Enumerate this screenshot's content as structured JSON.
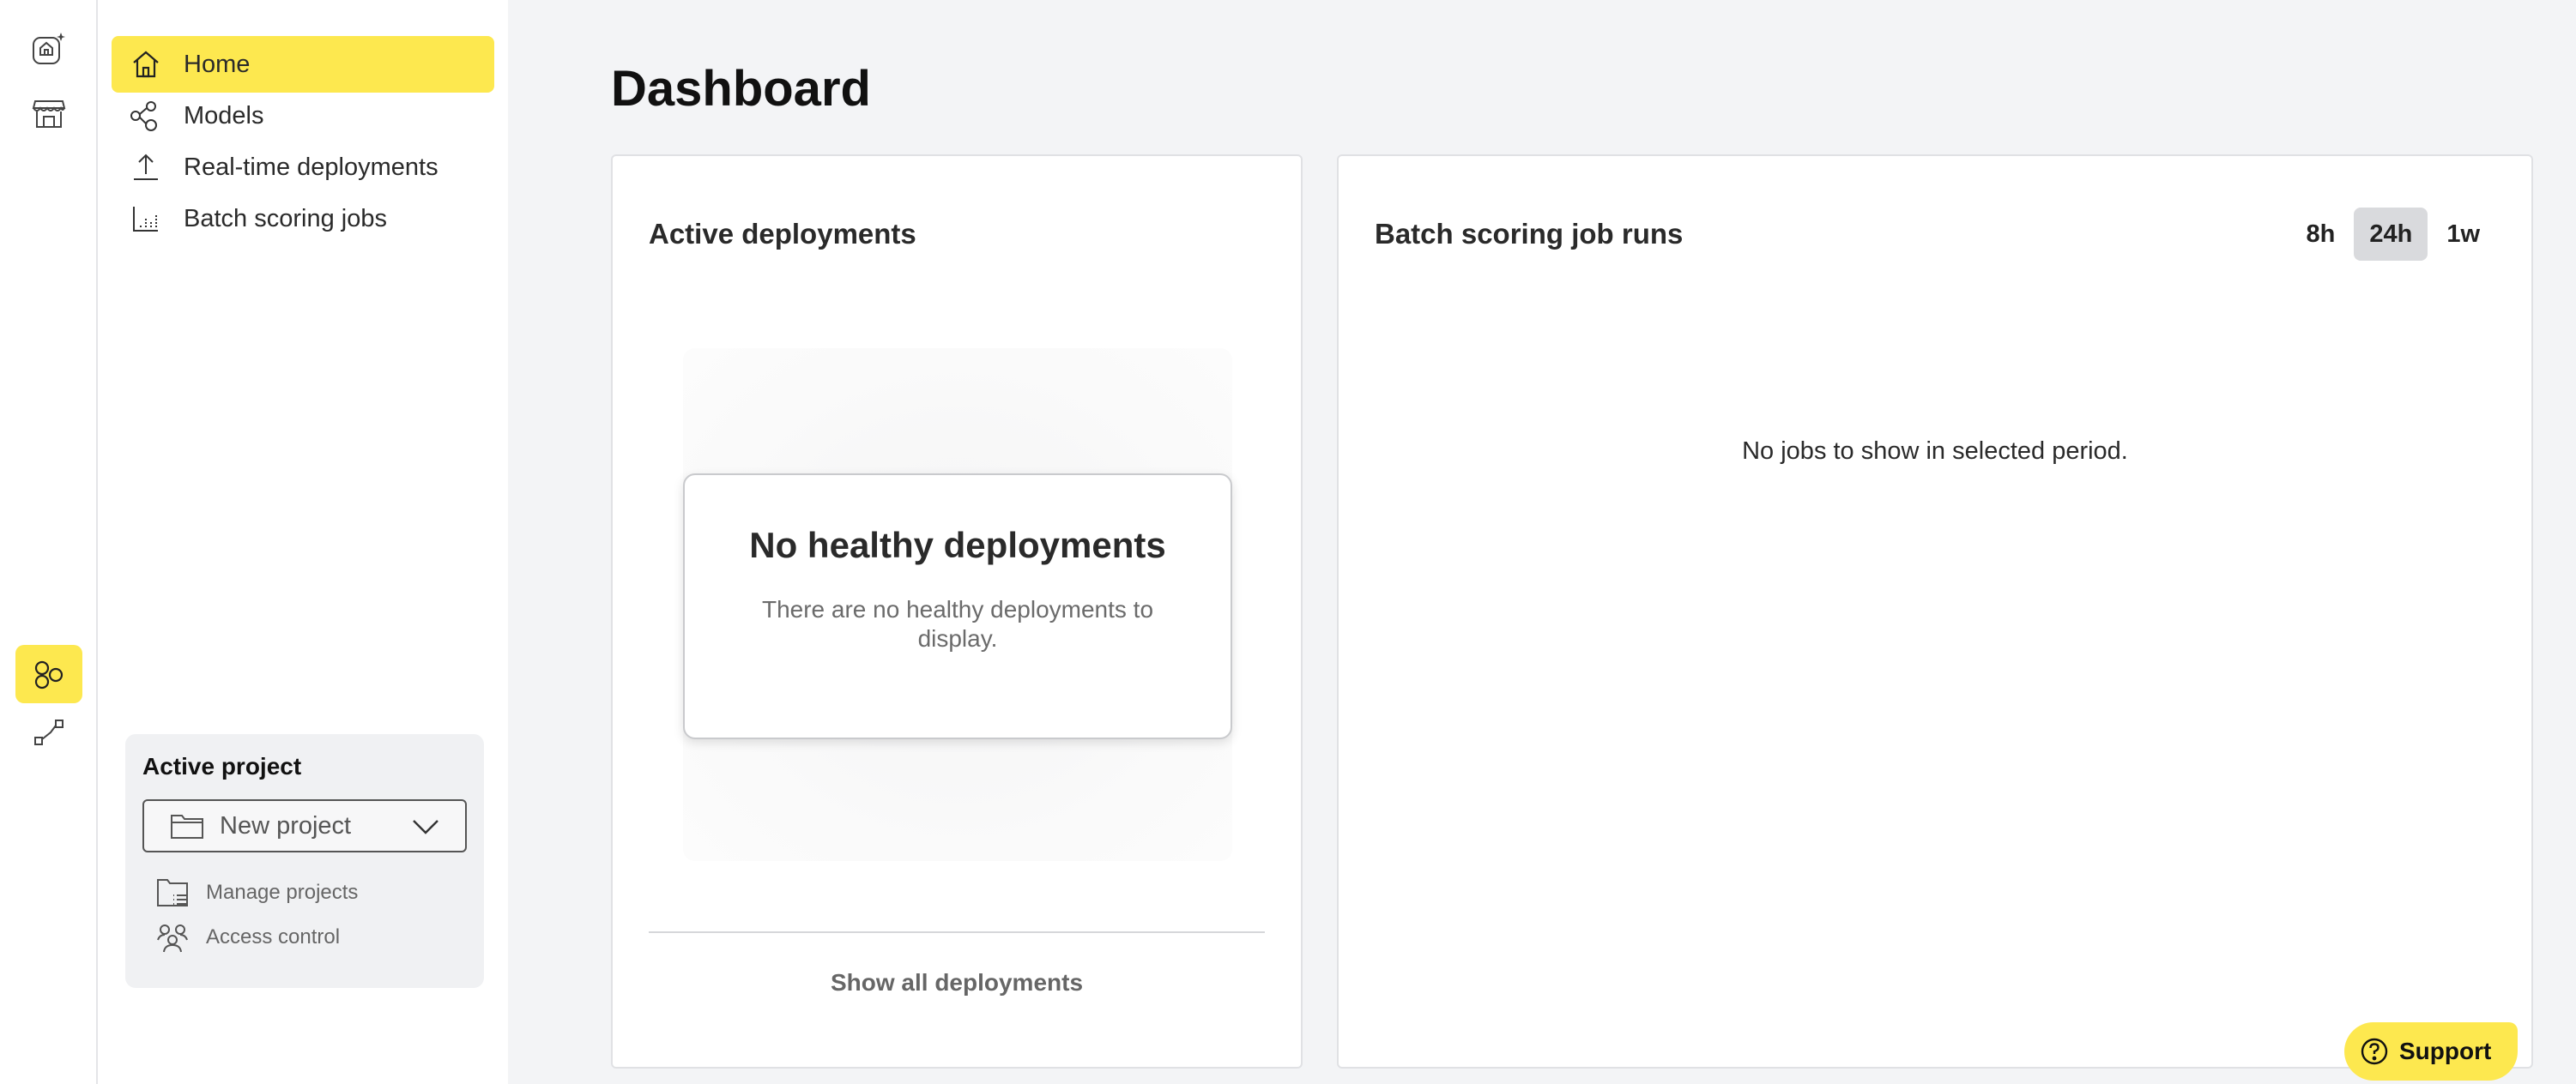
{
  "rail": {
    "items": [
      {
        "icon": "ai-home-icon"
      },
      {
        "icon": "store-icon"
      },
      {
        "icon": "models-hub-icon",
        "active": true
      },
      {
        "icon": "pipeline-icon"
      }
    ]
  },
  "sidebar": {
    "nav": [
      {
        "label": "Home",
        "icon": "home-icon",
        "active": true
      },
      {
        "label": "Models",
        "icon": "models-icon"
      },
      {
        "label": "Real-time deployments",
        "icon": "upload-icon"
      },
      {
        "label": "Batch scoring jobs",
        "icon": "batch-chart-icon"
      }
    ],
    "project": {
      "title": "Active project",
      "selected": "New project",
      "links": [
        {
          "label": "Manage projects",
          "icon": "folder-list-icon"
        },
        {
          "label": "Access control",
          "icon": "users-icon"
        }
      ]
    }
  },
  "main": {
    "title": "Dashboard",
    "active_deployments": {
      "title": "Active deployments",
      "empty_title": "No healthy deployments",
      "empty_message": "There are no healthy deployments to display.",
      "show_all": "Show all deployments"
    },
    "batch_runs": {
      "title": "Batch scoring job runs",
      "periods": [
        {
          "label": "8h"
        },
        {
          "label": "24h",
          "active": true
        },
        {
          "label": "1w"
        }
      ],
      "empty_message": "No jobs to show in selected period."
    }
  },
  "support": {
    "label": "Support",
    "icon": "help-circle-icon"
  },
  "colors": {
    "accent": "#fde84f",
    "background": "#f3f4f6"
  }
}
